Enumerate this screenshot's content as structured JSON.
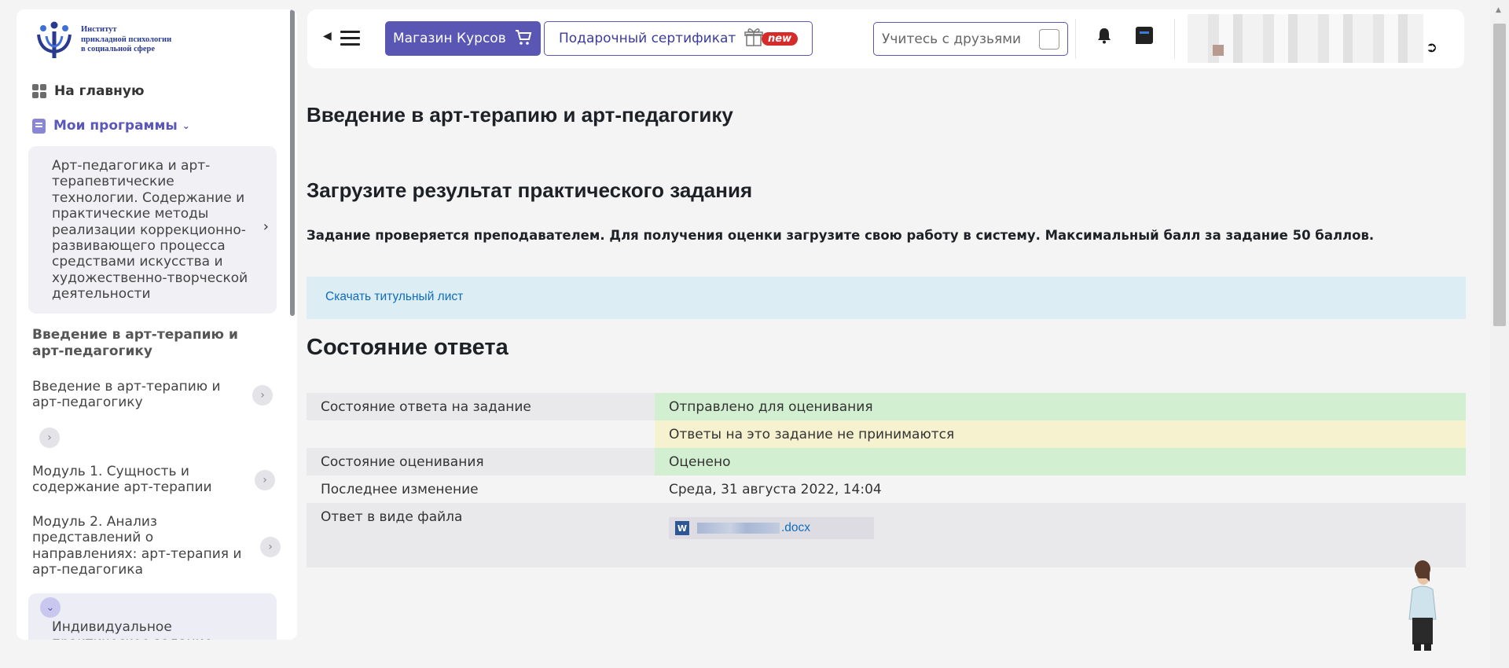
{
  "sidebar": {
    "logo_lines": [
      "Институт",
      "прикладной психологии",
      "в социальной сфере"
    ],
    "home_label": "На главную",
    "programs_label": "Мои программы",
    "program_card": "Арт-педагогика и арт-терапевтические технологии. Содержание и практические методы реализации коррекционно-развивающего процесса средствами искусства и художественно-творческой деятельности",
    "section_title": "Введение в арт-терапию и арт-педагогику",
    "items": [
      {
        "label": "Введение в арт-терапию и арт-педагогику"
      },
      {
        "label": ""
      },
      {
        "label": "Модуль 1. Сущность и содержание арт-терапии"
      },
      {
        "label": "Модуль 2. Анализ представлений о направлениях: арт-терапия и арт-педагогика"
      }
    ],
    "active_item": "Индивидуальное практическое задание"
  },
  "topbar": {
    "shop_label": "Магазин Курсов",
    "gift_label": "Подарочный сертификат",
    "gift_badge": "new",
    "friends_label": "Учитесь с друзьями"
  },
  "main": {
    "page_title": "Введение в арт-терапию и арт-педагогику",
    "upload_title": "Загрузите результат практического задания",
    "description": "Задание проверяется преподавателем. Для получения оценки загрузите свою работу в систему. Максимальный балл за задание 50 баллов.",
    "download_link": "Скачать титульный лист",
    "status_title": "Состояние ответа",
    "status_rows": [
      {
        "label": "Состояние ответа на задание",
        "value": "Отправлено для оценивания",
        "tone": "green"
      },
      {
        "label": "",
        "value": "Ответы на это задание не принимаются",
        "tone": "yellow"
      },
      {
        "label": "Состояние оценивания",
        "value": "Оценено",
        "tone": "green"
      },
      {
        "label": "Последнее изменение",
        "value": "Среда, 31 августа 2022, 14:04",
        "tone": "plain"
      },
      {
        "label": "Ответ в виде файла",
        "value": ".docx",
        "tone": "file"
      }
    ]
  },
  "colors": {
    "accent": "#5a57b4",
    "status_green": "#d3efd1",
    "status_yellow": "#f6f2cf",
    "info_bg": "#dcedf3",
    "link": "#0f6cbf"
  }
}
